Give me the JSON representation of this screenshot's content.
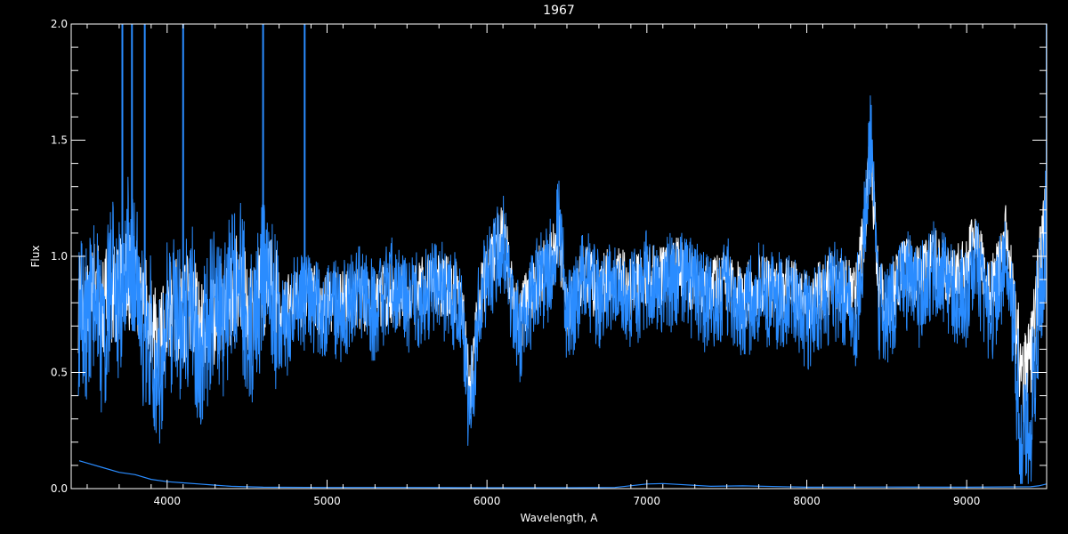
{
  "chart_data": {
    "type": "line",
    "title": "1967",
    "xlabel": "Wavelength, A",
    "ylabel": "Flux",
    "xlim": [
      3400,
      9500
    ],
    "ylim": [
      0.0,
      2.0
    ],
    "x_ticks": [
      4000,
      5000,
      6000,
      7000,
      8000,
      9000
    ],
    "x_tick_labels": [
      "4000",
      "5000",
      "6000",
      "7000",
      "8000",
      "9000"
    ],
    "y_ticks": [
      0.0,
      0.5,
      1.0,
      1.5,
      2.0
    ],
    "y_tick_labels": [
      "0.0",
      "0.5",
      "1.0",
      "1.5",
      "2.0"
    ],
    "grid": false,
    "colors": {
      "background": "#000000",
      "axes": "#ffffff",
      "spectrum": "#2a8cff",
      "model": "#ffffff",
      "error": "#2a8cff"
    },
    "series": [
      {
        "role": "model",
        "x": [
          3450,
          3500,
          3550,
          3600,
          3650,
          3700,
          3750,
          3800,
          3850,
          3900,
          3950,
          4000,
          4050,
          4100,
          4150,
          4200,
          4250,
          4300,
          4350,
          4400,
          4450,
          4500,
          4550,
          4600,
          4650,
          4700,
          4750,
          4800,
          4850,
          4900,
          4950,
          5000,
          5100,
          5200,
          5300,
          5400,
          5500,
          5600,
          5700,
          5800,
          5850,
          5890,
          5950,
          6000,
          6100,
          6150,
          6200,
          6300,
          6400,
          6450,
          6500,
          6550,
          6600,
          6650,
          6700,
          6800,
          6900,
          7000,
          7100,
          7200,
          7300,
          7400,
          7500,
          7600,
          7700,
          7800,
          7900,
          8000,
          8100,
          8200,
          8300,
          8350,
          8400,
          8450,
          8500,
          8600,
          8700,
          8800,
          8900,
          9000,
          9050,
          9100,
          9150,
          9200,
          9250,
          9300,
          9350,
          9400,
          9450,
          9500
        ],
        "y": [
          0.8,
          0.78,
          0.85,
          0.8,
          0.83,
          0.86,
          0.88,
          0.9,
          0.8,
          0.72,
          0.6,
          0.75,
          0.78,
          0.74,
          0.82,
          0.7,
          0.72,
          0.75,
          0.78,
          0.82,
          0.9,
          0.8,
          0.78,
          0.88,
          0.85,
          0.8,
          0.78,
          0.8,
          0.82,
          0.85,
          0.78,
          0.8,
          0.8,
          0.82,
          0.8,
          0.85,
          0.82,
          0.86,
          0.88,
          0.85,
          0.8,
          0.4,
          0.8,
          0.92,
          1.12,
          0.9,
          0.72,
          0.88,
          0.98,
          1.1,
          0.75,
          0.82,
          0.94,
          0.9,
          0.84,
          0.96,
          0.85,
          0.92,
          0.9,
          0.96,
          0.88,
          0.85,
          0.9,
          0.82,
          0.88,
          0.86,
          0.85,
          0.8,
          0.86,
          0.9,
          0.82,
          1.05,
          1.45,
          0.85,
          0.8,
          0.96,
          0.9,
          0.98,
          0.92,
          0.95,
          1.1,
          0.95,
          0.85,
          0.95,
          1.1,
          0.75,
          0.45,
          0.55,
          0.9,
          1.2
        ]
      },
      {
        "role": "observed",
        "x": [
          3450,
          3500,
          3550,
          3600,
          3650,
          3700,
          3750,
          3800,
          3850,
          3900,
          3950,
          4000,
          4050,
          4100,
          4150,
          4200,
          4250,
          4300,
          4350,
          4400,
          4450,
          4500,
          4550,
          4600,
          4650,
          4700,
          4750,
          4800,
          4850,
          4900,
          4950,
          5000,
          5100,
          5200,
          5300,
          5400,
          5500,
          5600,
          5700,
          5800,
          5850,
          5890,
          5950,
          6000,
          6100,
          6150,
          6200,
          6300,
          6400,
          6450,
          6500,
          6550,
          6600,
          6650,
          6700,
          6800,
          6900,
          7000,
          7100,
          7200,
          7300,
          7400,
          7500,
          7600,
          7700,
          7800,
          7900,
          8000,
          8100,
          8200,
          8300,
          8350,
          8400,
          8450,
          8500,
          8600,
          8700,
          8800,
          8900,
          9000,
          9050,
          9100,
          9150,
          9200,
          9250,
          9300,
          9350,
          9400,
          9450,
          9500
        ],
        "y": [
          0.75,
          0.7,
          0.9,
          0.6,
          0.95,
          0.8,
          1.0,
          0.95,
          0.7,
          0.65,
          0.5,
          0.72,
          0.8,
          0.65,
          0.85,
          0.55,
          0.7,
          0.78,
          0.72,
          0.85,
          0.95,
          0.72,
          0.7,
          0.92,
          0.8,
          0.75,
          0.7,
          0.82,
          0.78,
          0.8,
          0.75,
          0.78,
          0.76,
          0.85,
          0.75,
          0.9,
          0.78,
          0.84,
          0.86,
          0.8,
          0.75,
          0.28,
          0.78,
          0.9,
          1.08,
          0.85,
          0.65,
          0.85,
          0.95,
          1.15,
          0.7,
          0.8,
          0.92,
          0.88,
          0.8,
          0.93,
          0.8,
          0.9,
          0.85,
          0.92,
          0.85,
          0.78,
          0.88,
          0.75,
          0.85,
          0.8,
          0.82,
          0.72,
          0.82,
          0.85,
          0.7,
          1.0,
          1.52,
          0.78,
          0.72,
          0.92,
          0.82,
          0.95,
          0.85,
          0.8,
          1.05,
          0.8,
          0.75,
          0.85,
          1.05,
          0.62,
          0.2,
          0.3,
          0.8,
          1.15
        ]
      },
      {
        "role": "error",
        "x": [
          3450,
          3500,
          3600,
          3700,
          3800,
          3900,
          4000,
          4100,
          4200,
          4300,
          4400,
          4500,
          4600,
          5000,
          5500,
          6000,
          6500,
          6800,
          7000,
          7100,
          7200,
          7400,
          7600,
          8000,
          8500,
          9000,
          9400,
          9450,
          9500
        ],
        "y": [
          0.12,
          0.11,
          0.09,
          0.07,
          0.06,
          0.04,
          0.03,
          0.025,
          0.02,
          0.015,
          0.01,
          0.008,
          0.006,
          0.005,
          0.005,
          0.004,
          0.004,
          0.005,
          0.02,
          0.022,
          0.018,
          0.01,
          0.012,
          0.006,
          0.007,
          0.006,
          0.008,
          0.012,
          0.02
        ]
      }
    ],
    "emission_spikes": [
      {
        "x": 3720,
        "y": 2.0
      },
      {
        "x": 3780,
        "y": 2.0
      },
      {
        "x": 3860,
        "y": 2.0
      },
      {
        "x": 4100,
        "y": 2.0
      },
      {
        "x": 4600,
        "y": 2.0
      },
      {
        "x": 4860,
        "y": 2.0
      },
      {
        "x": 9500,
        "y": 2.0
      }
    ]
  }
}
